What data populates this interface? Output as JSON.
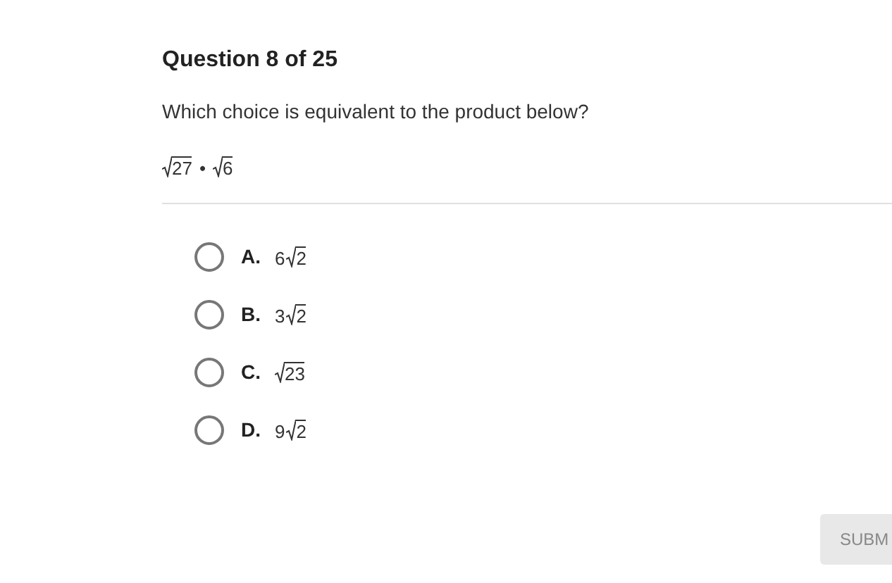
{
  "title": "Question 8 of 25",
  "prompt": "Which choice is equivalent to the product below?",
  "expression": {
    "operator": "•",
    "terms": [
      {
        "radicand": "27"
      },
      {
        "radicand": "6"
      }
    ]
  },
  "choices": [
    {
      "letter": "A.",
      "coefficient": "6",
      "radicand": "2",
      "selected": false
    },
    {
      "letter": "B.",
      "coefficient": "3",
      "radicand": "2",
      "selected": false
    },
    {
      "letter": "C.",
      "radicand": "23",
      "selected": false
    },
    {
      "letter": "D.",
      "coefficient": "9",
      "radicand": "2",
      "selected": false
    }
  ],
  "submit": {
    "label": "SUBM",
    "disabled": true
  }
}
